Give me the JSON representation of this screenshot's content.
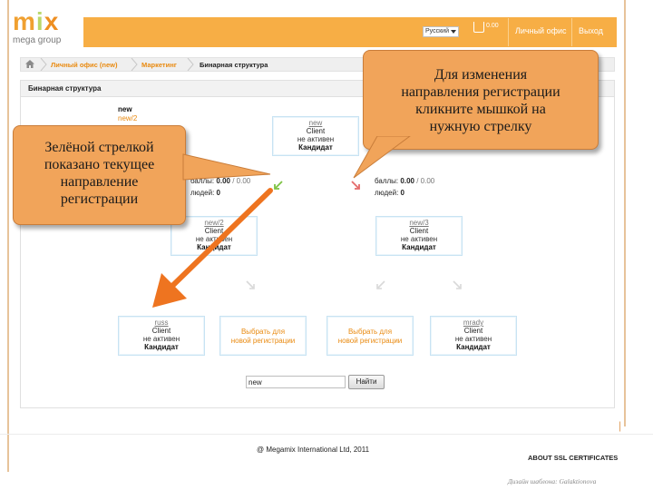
{
  "logo": {
    "brand": "mix",
    "subtitle": "mega group"
  },
  "header": {
    "language": "Русский",
    "cart_count": "0.00",
    "office_link": "Личный офис",
    "logout_link": "Выход"
  },
  "breadcrumb": {
    "items": [
      "Личный офис (new)",
      "Маркетинг",
      "Бинарная структура"
    ]
  },
  "panel": {
    "title": "Бинарная структура",
    "owner_name": "new",
    "owner_link": "new/2"
  },
  "tree": {
    "root": {
      "link": "new",
      "type": "Client",
      "status": "не активен",
      "rank": "Кандидат"
    },
    "left_stats": {
      "points_label": "баллы:",
      "points": "0.00",
      "points_total": "/ 0.00",
      "people_label": "людей:",
      "people": "0"
    },
    "right_stats": {
      "points_label": "баллы:",
      "points": "0.00",
      "points_total": "/ 0.00",
      "people_label": "людей:",
      "people": "0"
    },
    "level2": [
      {
        "link": "new/2",
        "type": "Client",
        "status": "не активен",
        "rank": "Кандидат"
      },
      {
        "link": "new/3",
        "type": "Client",
        "status": "не активен",
        "rank": "Кандидат"
      }
    ],
    "level3": [
      {
        "kind": "node",
        "link": "russ",
        "type": "Client",
        "status": "не активен",
        "rank": "Кандидат"
      },
      {
        "kind": "empty",
        "text1": "Выбрать для",
        "text2": "новой регистрации"
      },
      {
        "kind": "empty",
        "text1": "Выбрать для",
        "text2": "новой регистрации"
      },
      {
        "kind": "node",
        "link": "mrady",
        "type": "Client",
        "status": "не активен",
        "rank": "Кандидат"
      }
    ]
  },
  "search": {
    "value": "new",
    "button": "Найти"
  },
  "callouts": {
    "right": [
      "Для изменения",
      "направления регистрации",
      "кликните мышкой на",
      "нужную стрелку"
    ],
    "left": [
      "Зелёной стрелкой",
      "показано текущее",
      "направление",
      "регистрации"
    ]
  },
  "footer": {
    "copyright": "@ Megamix International Ltd, 2011",
    "ssl": "ABOUT SSL CERTIFICATES",
    "credit": "Дизайн шаблона: Galaktionova"
  },
  "colors": {
    "header": "#f7ae45",
    "accent_link": "#e98a10",
    "callout": "#f1a45a",
    "pointer_arrow": "#ee7420",
    "node_border": "#c8e3f3",
    "active_arrow": "#7cc242",
    "inactive_arrow": "#e46a6a"
  }
}
